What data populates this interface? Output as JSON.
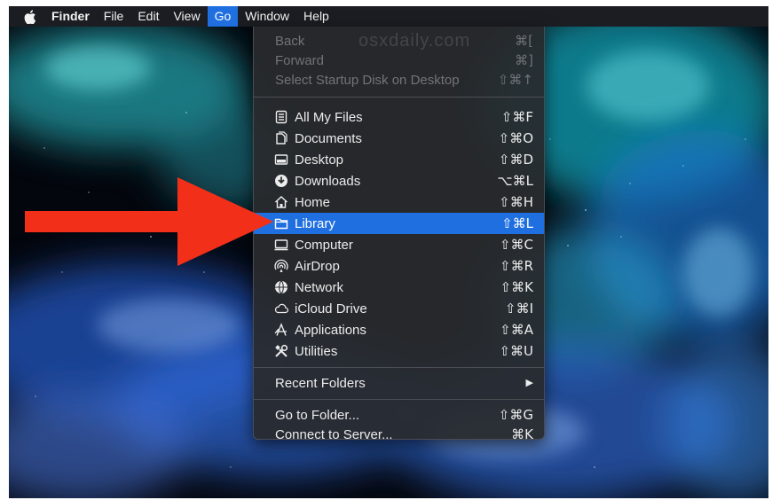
{
  "menubar": {
    "apple_icon": "apple-logo",
    "items": [
      {
        "label": "Finder"
      },
      {
        "label": "File"
      },
      {
        "label": "Edit"
      },
      {
        "label": "View"
      },
      {
        "label": "Go"
      },
      {
        "label": "Window"
      },
      {
        "label": "Help"
      }
    ]
  },
  "watermark": "osxdaily.com",
  "go_menu": {
    "top_items": [
      {
        "label": "Back",
        "shortcut": "⌘[",
        "enabled": false
      },
      {
        "label": "Forward",
        "shortcut": "⌘]",
        "enabled": false
      },
      {
        "label": "Select Startup Disk on Desktop",
        "shortcut": "⇧⌘↑",
        "enabled": false
      }
    ],
    "places": [
      {
        "label": "All My Files",
        "shortcut": "⇧⌘F",
        "icon": "all-files-icon"
      },
      {
        "label": "Documents",
        "shortcut": "⇧⌘O",
        "icon": "documents-icon"
      },
      {
        "label": "Desktop",
        "shortcut": "⇧⌘D",
        "icon": "desktop-icon"
      },
      {
        "label": "Downloads",
        "shortcut": "⌥⌘L",
        "icon": "downloads-icon"
      },
      {
        "label": "Home",
        "shortcut": "⇧⌘H",
        "icon": "home-icon"
      },
      {
        "label": "Library",
        "shortcut": "⇧⌘L",
        "icon": "folder-icon",
        "highlighted": true
      },
      {
        "label": "Computer",
        "shortcut": "⇧⌘C",
        "icon": "computer-icon"
      },
      {
        "label": "AirDrop",
        "shortcut": "⇧⌘R",
        "icon": "airdrop-icon"
      },
      {
        "label": "Network",
        "shortcut": "⇧⌘K",
        "icon": "network-icon"
      },
      {
        "label": "iCloud Drive",
        "shortcut": "⇧⌘I",
        "icon": "cloud-icon"
      },
      {
        "label": "Applications",
        "shortcut": "⇧⌘A",
        "icon": "applications-icon"
      },
      {
        "label": "Utilities",
        "shortcut": "⇧⌘U",
        "icon": "utilities-icon"
      }
    ],
    "recent": {
      "label": "Recent Folders",
      "submenu_glyph": "▶"
    },
    "bottom_items": [
      {
        "label": "Go to Folder...",
        "shortcut": "⇧⌘G"
      },
      {
        "label": "Connect to Server...",
        "shortcut": "⌘K"
      }
    ]
  },
  "colors": {
    "highlight": "#1f6fe0",
    "arrow": "#f2301a",
    "menubar": "#1b1d22"
  }
}
